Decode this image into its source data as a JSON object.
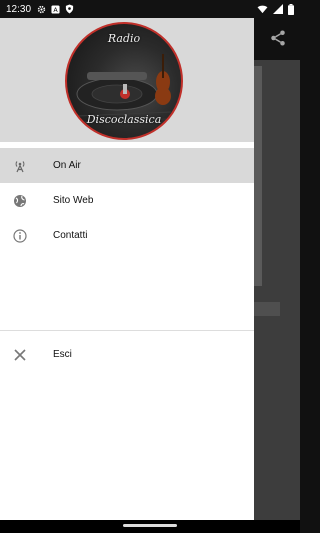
{
  "status_bar": {
    "time": "12:30",
    "left_icons": [
      "gear-icon",
      "a-badge-icon",
      "shield-icon"
    ],
    "right_icons": [
      "wifi-icon",
      "signal-icon",
      "battery-icon"
    ]
  },
  "toolbar": {
    "share_icon": "share-icon"
  },
  "drawer": {
    "logo": {
      "top_text": "Radio",
      "bottom_text": "Discoclassica"
    },
    "items": [
      {
        "label": "On Air",
        "icon": "antenna-icon",
        "active": true
      },
      {
        "label": "Sito Web",
        "icon": "globe-icon",
        "active": false
      },
      {
        "label": "Contatti",
        "icon": "info-icon",
        "active": false
      }
    ],
    "secondary_items": [
      {
        "label": "Esci",
        "icon": "close-icon"
      }
    ]
  },
  "colors": {
    "header_bg": "#d9d9d9",
    "active_item_bg": "#d9d9d9",
    "logo_border": "#c0302a",
    "toolbar_bg": "#1b1b1b"
  }
}
